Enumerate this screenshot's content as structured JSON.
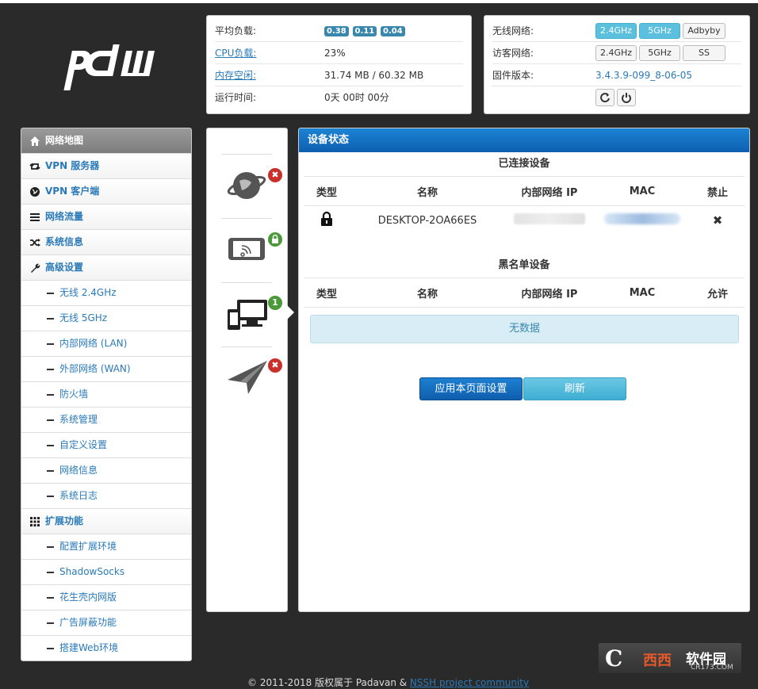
{
  "brand": {
    "logo_text": "pdn"
  },
  "status": {
    "load_label": "平均负载:",
    "load_values": [
      "0.38",
      "0.11",
      "0.04"
    ],
    "cpu_label": "CPU负载:",
    "cpu_value": "23%",
    "mem_label": "内存空闲:",
    "mem_value": "31.74 MB / 60.32 MB",
    "uptime_label": "运行时间:",
    "uptime_value": "0天 00时 00分"
  },
  "wireless": {
    "wireless_label": "无线网络:",
    "wireless_buttons": [
      "2.4GHz",
      "5GHz",
      "Adbyby"
    ],
    "guest_label": "访客网络:",
    "guest_buttons": [
      "2.4GHz",
      "5GHz",
      "SS"
    ],
    "firmware_label": "固件版本:",
    "firmware_value": "3.4.3.9-099_8-06-05",
    "icons": [
      "refresh-icon",
      "power-icon"
    ]
  },
  "sidebar": {
    "items": [
      {
        "label": "网络地图",
        "icon": "home-icon"
      },
      {
        "label": "VPN 服务器",
        "icon": "retweet-icon"
      },
      {
        "label": "VPN 客户端",
        "icon": "globe-icon"
      },
      {
        "label": "网络流量",
        "icon": "list-icon"
      },
      {
        "label": "系统信息",
        "icon": "shuffle-icon"
      },
      {
        "label": "高级设置",
        "icon": "wrench-icon"
      },
      {
        "label": "无线 2.4GHz"
      },
      {
        "label": "无线 5GHz"
      },
      {
        "label": "内部网络 (LAN)"
      },
      {
        "label": "外部网络 (WAN)"
      },
      {
        "label": "防火墙"
      },
      {
        "label": "系统管理"
      },
      {
        "label": "自定义设置"
      },
      {
        "label": "网络信息"
      },
      {
        "label": "系统日志"
      },
      {
        "label": "扩展功能",
        "icon": "grid-icon"
      },
      {
        "label": "配置扩展环境"
      },
      {
        "label": "ShadowSocks"
      },
      {
        "label": "花生壳内网版"
      },
      {
        "label": "广告屏蔽功能"
      },
      {
        "label": "搭建Web环境"
      }
    ]
  },
  "icon_column": {
    "items": [
      {
        "icon": "internet-globe-icon",
        "badge": "✖",
        "badge_color": "#c9302c"
      },
      {
        "icon": "wireless-tablet-icon",
        "badge": "lock",
        "badge_color": "#4a9a3a"
      },
      {
        "icon": "clients-monitor-icon",
        "badge": "1",
        "badge_color": "#4a9a3a"
      },
      {
        "icon": "paper-plane-icon",
        "badge": "✖",
        "badge_color": "#c9302c"
      }
    ]
  },
  "panel": {
    "title": "设备状态",
    "connected_title": "已连接设备",
    "connected_headers": [
      "类型",
      "名称",
      "内部网络 IP",
      "MAC",
      "禁止"
    ],
    "connected_rows": [
      {
        "type_icon": "lock-icon",
        "name": "DESKTOP-2OA66ES",
        "action": "✖"
      }
    ],
    "blacklist_title": "黑名单设备",
    "blacklist_headers": [
      "类型",
      "名称",
      "内部网络 IP",
      "MAC",
      "允许"
    ],
    "no_data": "无数据",
    "apply_button": "应用本页面设置",
    "refresh_button": "刷新"
  },
  "footer": {
    "copyright": "© 2011-2018 版权属于 Padavan & ",
    "link": "NSSH project community"
  },
  "watermark": {
    "mark": "C",
    "word": "西西",
    "brand": "软件园",
    "site": "CR173.COM"
  }
}
